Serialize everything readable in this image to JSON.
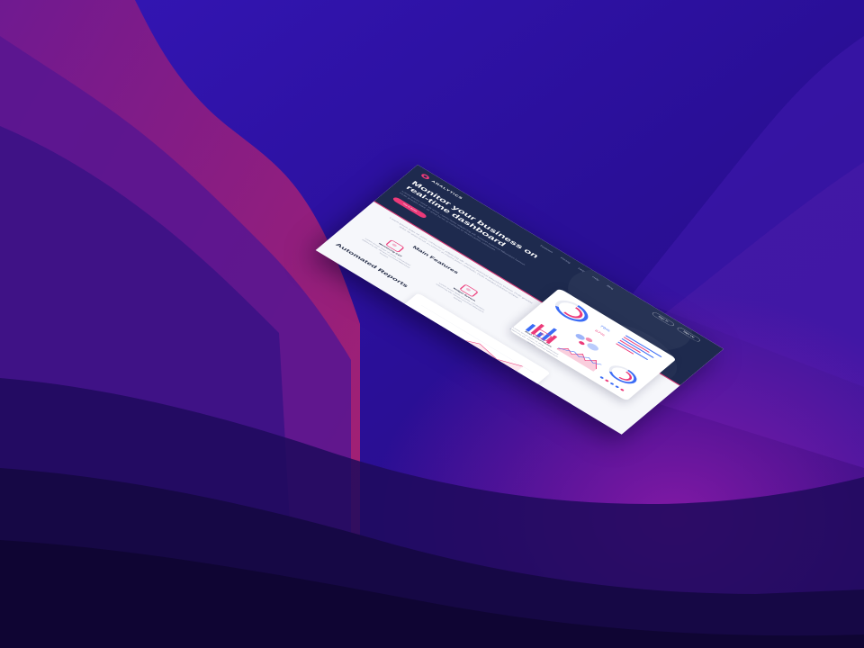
{
  "background": {
    "colors": [
      "#2a0f86",
      "#3a13a8",
      "#6a1aa5",
      "#1e0a5a",
      "#12063c"
    ]
  },
  "site": {
    "logo_text": "ANALYTICS",
    "nav": [
      "Features",
      "Pricing",
      "FAQ",
      "Help",
      "Blog"
    ],
    "sign_in_label": "Sign In",
    "sign_up_label": "Sign Up",
    "hero_title": "Monitor your business on real-time dashboard",
    "hero_subtitle": "Lorem ipsum dolor sit amet, consectetur adipiscing elit. Aenean euismod bibendum laoreet. Proin gravida dolor sit amet lacus accumsan et viverra justo commodo.",
    "cta_label": "Try It Now",
    "intro_text": "Lorem ipsum dolor sit amet, consectetur adipiscing elit. Aenean euismod bibendum laoreet. Proin gravida dolor sit amet lacus accumsan et viverra justo commodo. Proin sodales pulvinar tempor.",
    "features_title": "Main Features",
    "features": [
      {
        "name": "Monitoring 24/7",
        "icon": "monitor-icon",
        "desc": "Lorem ipsum dolor sit amet, consectetur adipiscing elit. Aenean euismod bibendum laoreet."
      },
      {
        "name": "Widget System",
        "icon": "widget-icon",
        "desc": "Lorem ipsum dolor sit amet, consectetur adipiscing elit. Aenean euismod bibendum laoreet."
      },
      {
        "name": "Best Performance",
        "icon": "rocket-icon",
        "desc": "Lorem ipsum dolor sit amet, consectetur adipiscing elit. Aenean euismod bibendum laoreet."
      }
    ],
    "reports_title": "Automated Reports",
    "preview": {
      "stat_1": "79%",
      "stat_2": "67%"
    },
    "colors": {
      "hero_bg": "#1e2a4e",
      "accent": "#ec3a79",
      "secondary": "#3b6cf6",
      "page_bg": "#f6f7fb"
    }
  }
}
